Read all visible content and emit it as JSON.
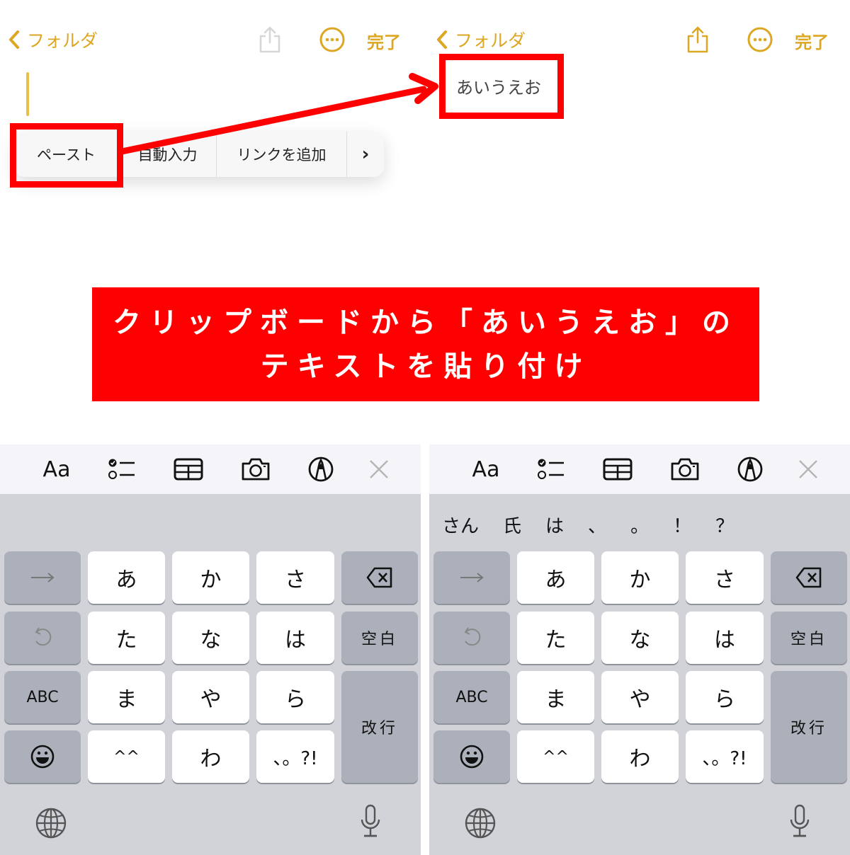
{
  "nav": {
    "back_label": "フォルダ",
    "done_label": "完了",
    "accent_color": "#dca722"
  },
  "edit_menu": {
    "items": [
      "ペースト",
      "自動入力",
      "リンクを追加"
    ],
    "more_label": "›"
  },
  "note": {
    "pasted_text": "あいうえお"
  },
  "banner": {
    "line1": "クリップボードから「あいうえお」の",
    "line2": "テキストを貼り付け",
    "color": "#ff0000"
  },
  "keyboard": {
    "toolbar": {
      "format_label": "Aa",
      "icons": [
        "checklist-icon",
        "table-icon",
        "camera-icon",
        "markup-icon",
        "close-icon"
      ]
    },
    "predictions": [
      "さん",
      "氏",
      "は",
      "、",
      "。",
      "！",
      "？"
    ],
    "rows": [
      {
        "side": "→",
        "keys": [
          "あ",
          "か",
          "さ"
        ],
        "action": "delete"
      },
      {
        "side": "undo",
        "keys": [
          "た",
          "な",
          "は"
        ],
        "action": "空白"
      },
      {
        "side": "ABC",
        "keys": [
          "ま",
          "や",
          "ら"
        ],
        "action": "改行"
      },
      {
        "side": "emoji",
        "keys": [
          "^^",
          "わ",
          "、。?!"
        ]
      }
    ]
  }
}
